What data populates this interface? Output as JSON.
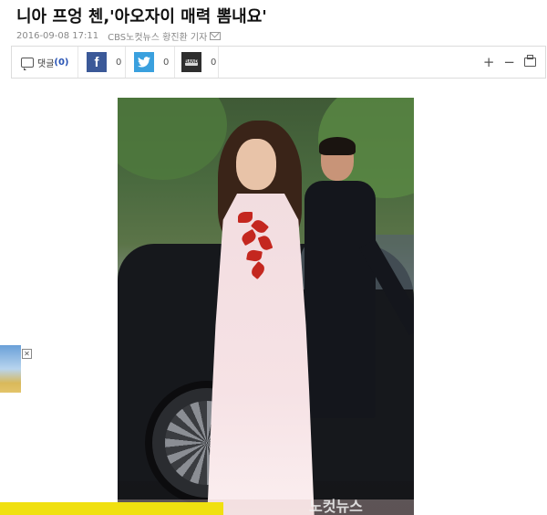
{
  "article": {
    "title": "니아 프엉 첸,'아오자이 매력 뽐내요'",
    "date": "2016-09-08 17:11",
    "byline": "CBS노컷뉴스 황진환 기자"
  },
  "toolbar": {
    "comment_label": "댓글",
    "comment_count": "(0)",
    "facebook_glyph": "f",
    "facebook_count": "0",
    "twitter_count": "0",
    "band_label": "BAND",
    "band_count": "0",
    "zoom_in": "+",
    "zoom_out": "−"
  },
  "photo": {
    "watermark": "노컷뉴스"
  },
  "ad": {
    "close_glyph": "✕"
  },
  "icons": [
    "comment-icon",
    "facebook-icon",
    "twitter-icon",
    "band-icon",
    "zoom-in-icon",
    "zoom-out-icon",
    "print-icon",
    "mail-icon",
    "close-icon"
  ],
  "colors": {
    "facebook": "#3b5998",
    "twitter": "#3aa0de",
    "band": "#2e2e2e",
    "comment_count": "#2a55b5",
    "bottom_bar": "#f0e010"
  }
}
